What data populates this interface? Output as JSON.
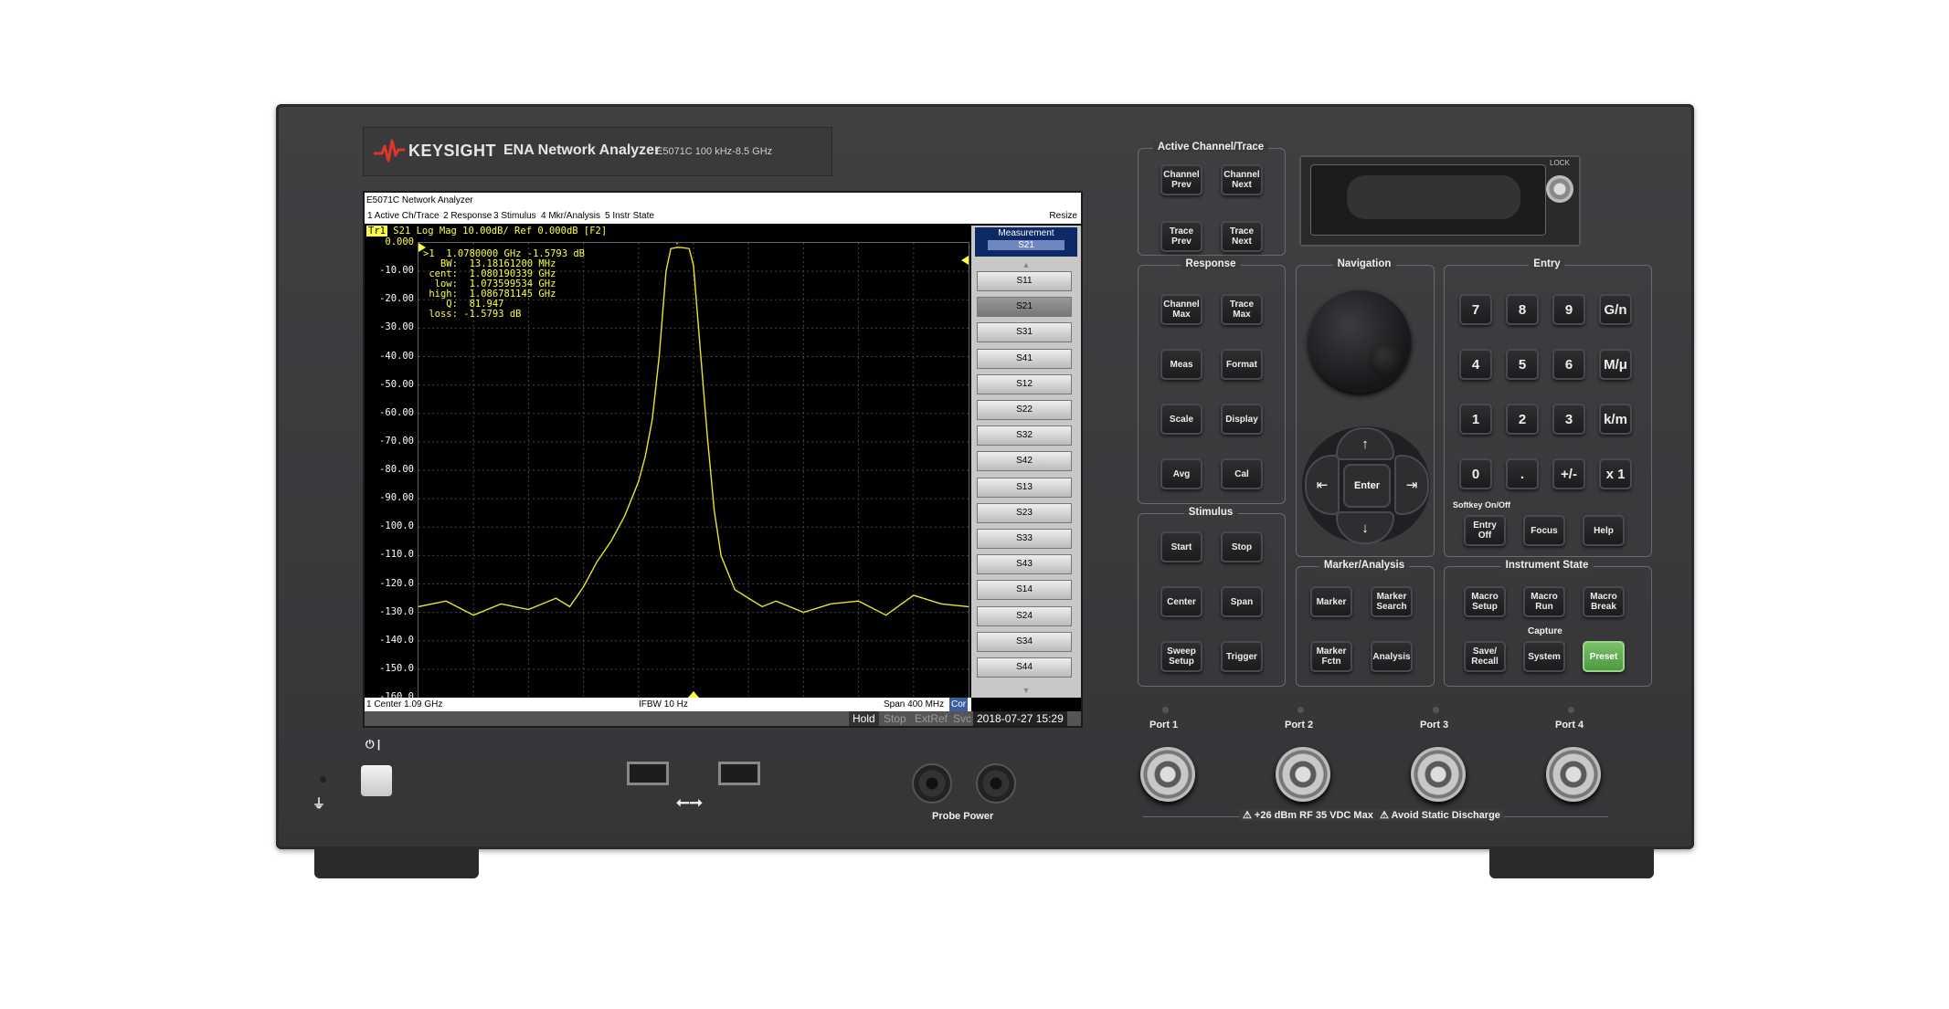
{
  "brand": {
    "name": "KEYSIGHT",
    "model": "ENA Network Analyzer",
    "sub": "E5071C   100 kHz-8.5 GHz"
  },
  "screen": {
    "title": "E5071C Network Analyzer",
    "menus": [
      "1 Active Ch/Trace",
      "2 Response",
      "3 Stimulus",
      "4 Mkr/Analysis",
      "5 Instr State"
    ],
    "resize": "Resize",
    "trace_tag": "Tr1",
    "trace_info": "S21 Log Mag 10.00dB/ Ref 0.000dB [F2]",
    "readout": [
      ">1  1.0780000 GHz -1.5793 dB",
      "   BW:  13.18161200 MHz",
      " cent:  1.080190339 GHz",
      "  low:  1.073599534 GHz",
      " high:  1.086781145 GHz",
      "    Q:  81.947",
      " loss: -1.5793 dB"
    ],
    "marker_num": "1",
    "status": {
      "left": "1  Center 1.09 GHz",
      "mid": "IFBW 10 Hz",
      "right": "Span 400 MHz",
      "cor": "Cor"
    },
    "status2": {
      "hold": "Hold",
      "stop": "Stop",
      "extref": "ExtRef",
      "svc": "Svc",
      "datetime": "2018-07-27 15:29"
    }
  },
  "chart_data": {
    "type": "line",
    "y_ticks": [
      "0.000",
      "-10.00",
      "-20.00",
      "-30.00",
      "-40.00",
      "-50.00",
      "-60.00",
      "-70.00",
      "-80.00",
      "-90.00",
      "-100.0",
      "-110.0",
      "-120.0",
      "-130.0",
      "-140.0",
      "-150.0",
      "-160.0"
    ],
    "ylim": [
      -160,
      0
    ],
    "xlim": [
      0.89,
      1.29
    ],
    "x_center_ghz": 1.09,
    "span_mhz": 400,
    "grid": true,
    "series": [
      {
        "color": "#e6e630",
        "x": [
          0.89,
          0.91,
          0.93,
          0.95,
          0.97,
          0.99,
          1.0,
          1.01,
          1.02,
          1.03,
          1.04,
          1.05,
          1.055,
          1.06,
          1.065,
          1.07,
          1.0735,
          1.078,
          1.0802,
          1.0868,
          1.09,
          1.095,
          1.1,
          1.105,
          1.11,
          1.12,
          1.13,
          1.14,
          1.15,
          1.17,
          1.19,
          1.21,
          1.23,
          1.25,
          1.27,
          1.29
        ],
        "y": [
          -128,
          -126,
          -131,
          -127,
          -129,
          -125,
          -128,
          -121,
          -112,
          -105,
          -96,
          -84,
          -75,
          -62,
          -40,
          -10,
          -2,
          -1.6,
          -1.58,
          -2,
          -8,
          -38,
          -68,
          -94,
          -110,
          -122,
          -125,
          -128,
          -126,
          -130,
          -127,
          -126,
          -131,
          -124,
          -127,
          -128
        ]
      }
    ]
  },
  "softkeys": {
    "title": "Measurement",
    "value": "S21",
    "items": [
      "S11",
      "S21",
      "S31",
      "S41",
      "S12",
      "S22",
      "S32",
      "S42",
      "S13",
      "S23",
      "S33",
      "S43",
      "S14",
      "S24",
      "S34",
      "S44"
    ]
  },
  "panel": {
    "active": {
      "label": "Active Channel/Trace",
      "keys": [
        "Channel\nPrev",
        "Channel\nNext",
        "Trace\nPrev",
        "Trace\nNext"
      ]
    },
    "response": {
      "label": "Response",
      "keys": [
        "Channel\nMax",
        "Trace\nMax",
        "Meas",
        "Format",
        "Scale",
        "Display",
        "Avg",
        "Cal"
      ]
    },
    "stimulus": {
      "label": "Stimulus",
      "keys": [
        "Start",
        "Stop",
        "Center",
        "Span",
        "Sweep\nSetup",
        "Trigger"
      ]
    },
    "navigation": {
      "label": "Navigation",
      "enter": "Enter",
      "up": "↑",
      "down": "↓",
      "left": "⇤",
      "right": "⇥"
    },
    "marker": {
      "label": "Marker/Analysis",
      "keys": [
        "Marker",
        "Marker\nSearch",
        "Marker\nFctn",
        "Analysis"
      ]
    },
    "entry": {
      "label": "Entry",
      "keys": [
        "7",
        "8",
        "9",
        "G/n",
        "4",
        "5",
        "6",
        "M/μ",
        "1",
        "2",
        "3",
        "k/m",
        "0",
        ".",
        "+/-",
        "x 1"
      ],
      "softkey_label": "Softkey On/Off",
      "bottom": [
        "Entry\nOff",
        "Focus",
        "Help"
      ]
    },
    "instr": {
      "label": "Instrument State",
      "keys": [
        "Macro\nSetup",
        "Macro\nRun",
        "Macro\nBreak"
      ],
      "capture": "Capture",
      "bottom": [
        "Save/\nRecall",
        "System",
        "Preset"
      ]
    },
    "lock": "LOCK"
  },
  "ports": [
    "Port 1",
    "Port 2",
    "Port 3",
    "Port 4"
  ],
  "port_warning": "+26 dBm RF  35 VDC Max",
  "static_warning": "Avoid Static Discharge",
  "probe_power": "Probe Power",
  "colors": {
    "trace": "#e6e630",
    "preset": "#5aa84c"
  }
}
